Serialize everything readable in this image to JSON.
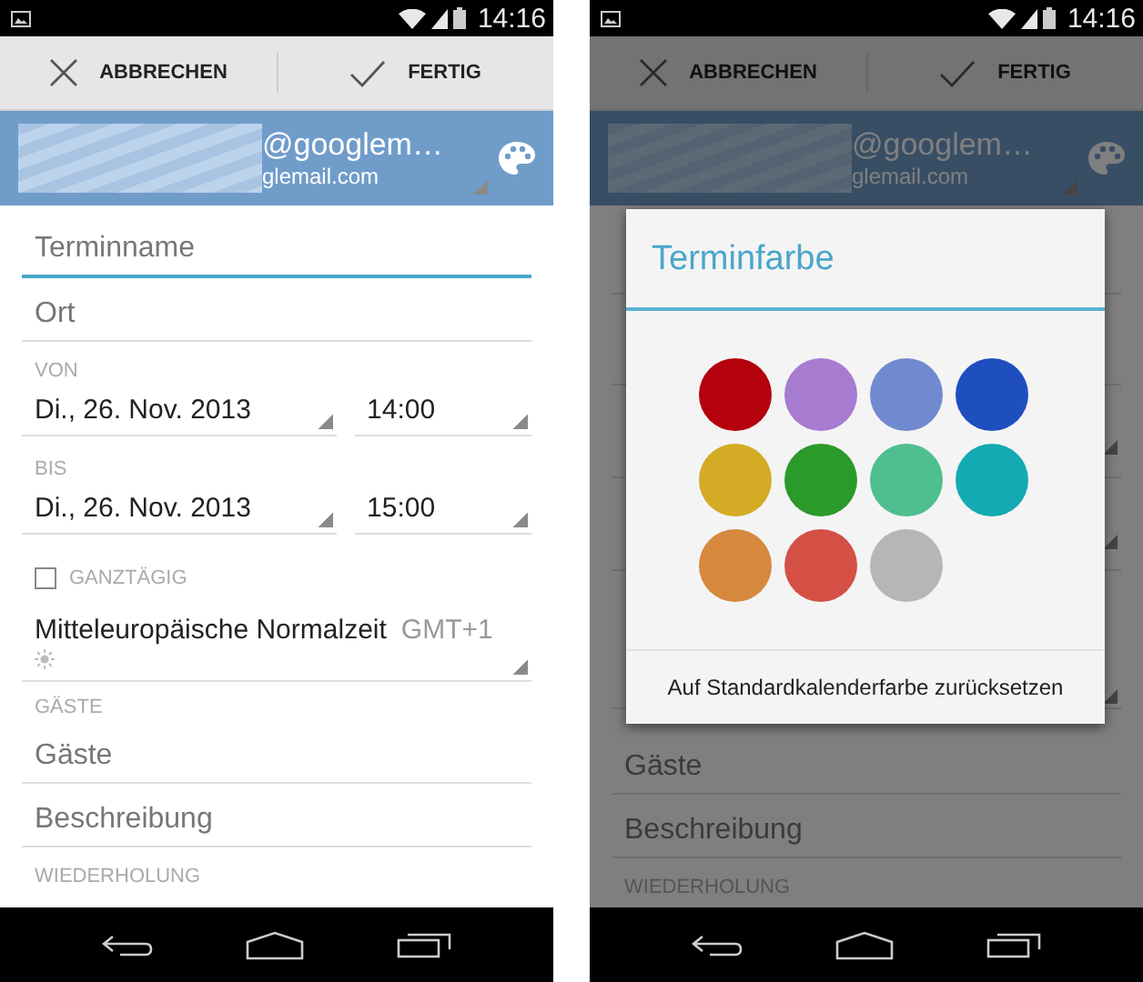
{
  "screens": [
    {
      "status_bar": {
        "time": "14:16"
      },
      "action_bar": {
        "buttons": [
          {
            "kind": "cancel",
            "label": "ABBRECHEN"
          },
          {
            "kind": "done",
            "label": "FERTIG"
          }
        ]
      },
      "account": {
        "email_line_1": "@googlem…",
        "email_line_2": "glemail.com"
      },
      "fields": [
        {
          "kind": "text",
          "placeholder": "Terminname",
          "focused": true
        },
        {
          "kind": "text",
          "placeholder": "Ort",
          "focused": false
        },
        {
          "kind": "label",
          "text": "VON"
        },
        {
          "kind": "datetime",
          "date": "Di., 26. Nov. 2013",
          "time": "14:00"
        },
        {
          "kind": "label",
          "text": "BIS"
        },
        {
          "kind": "datetime",
          "date": "Di., 26. Nov. 2013",
          "time": "15:00"
        },
        {
          "kind": "checkbox",
          "label": "GANZTÄGIG",
          "checked": false
        },
        {
          "kind": "timezone",
          "name": "Mitteleuropäische Normalzeit",
          "offset": "GMT+1"
        },
        {
          "kind": "label",
          "text": "GÄSTE"
        },
        {
          "kind": "text",
          "placeholder": "Gäste",
          "focused": false
        },
        {
          "kind": "text",
          "placeholder": "Beschreibung",
          "focused": false
        },
        {
          "kind": "label",
          "text": "WIEDERHOLUNG"
        }
      ]
    },
    {
      "status_bar": {
        "time": "14:16"
      },
      "action_bar": {
        "buttons": [
          {
            "kind": "cancel",
            "label": "ABBRECHEN"
          },
          {
            "kind": "done",
            "label": "FERTIG"
          }
        ]
      },
      "account": {
        "email_line_1": "@googlem…",
        "email_line_2": "glemail.com"
      },
      "fields": [
        {
          "kind": "text",
          "placeholder": "Gäste",
          "focused": false
        },
        {
          "kind": "text",
          "placeholder": "Beschreibung",
          "focused": false
        },
        {
          "kind": "label",
          "text": "WIEDERHOLUNG"
        }
      ],
      "dialog": {
        "title": "Terminfarbe",
        "colors": [
          {
            "color": "#b5000e"
          },
          {
            "color": "#a77bd0"
          },
          {
            "color": "#7189cf"
          },
          {
            "color": "#1f4fbf"
          },
          {
            "color": "#d3ab25"
          },
          {
            "color": "#2a9a2b"
          },
          {
            "color": "#4fbf8f"
          },
          {
            "color": "#14aab3"
          },
          {
            "color": "#d6883f"
          },
          {
            "color": "#d45045"
          },
          {
            "color": "#b6b6b6"
          }
        ],
        "reset_button": "Auf Standardkalenderfarbe zurücksetzen"
      }
    }
  ]
}
